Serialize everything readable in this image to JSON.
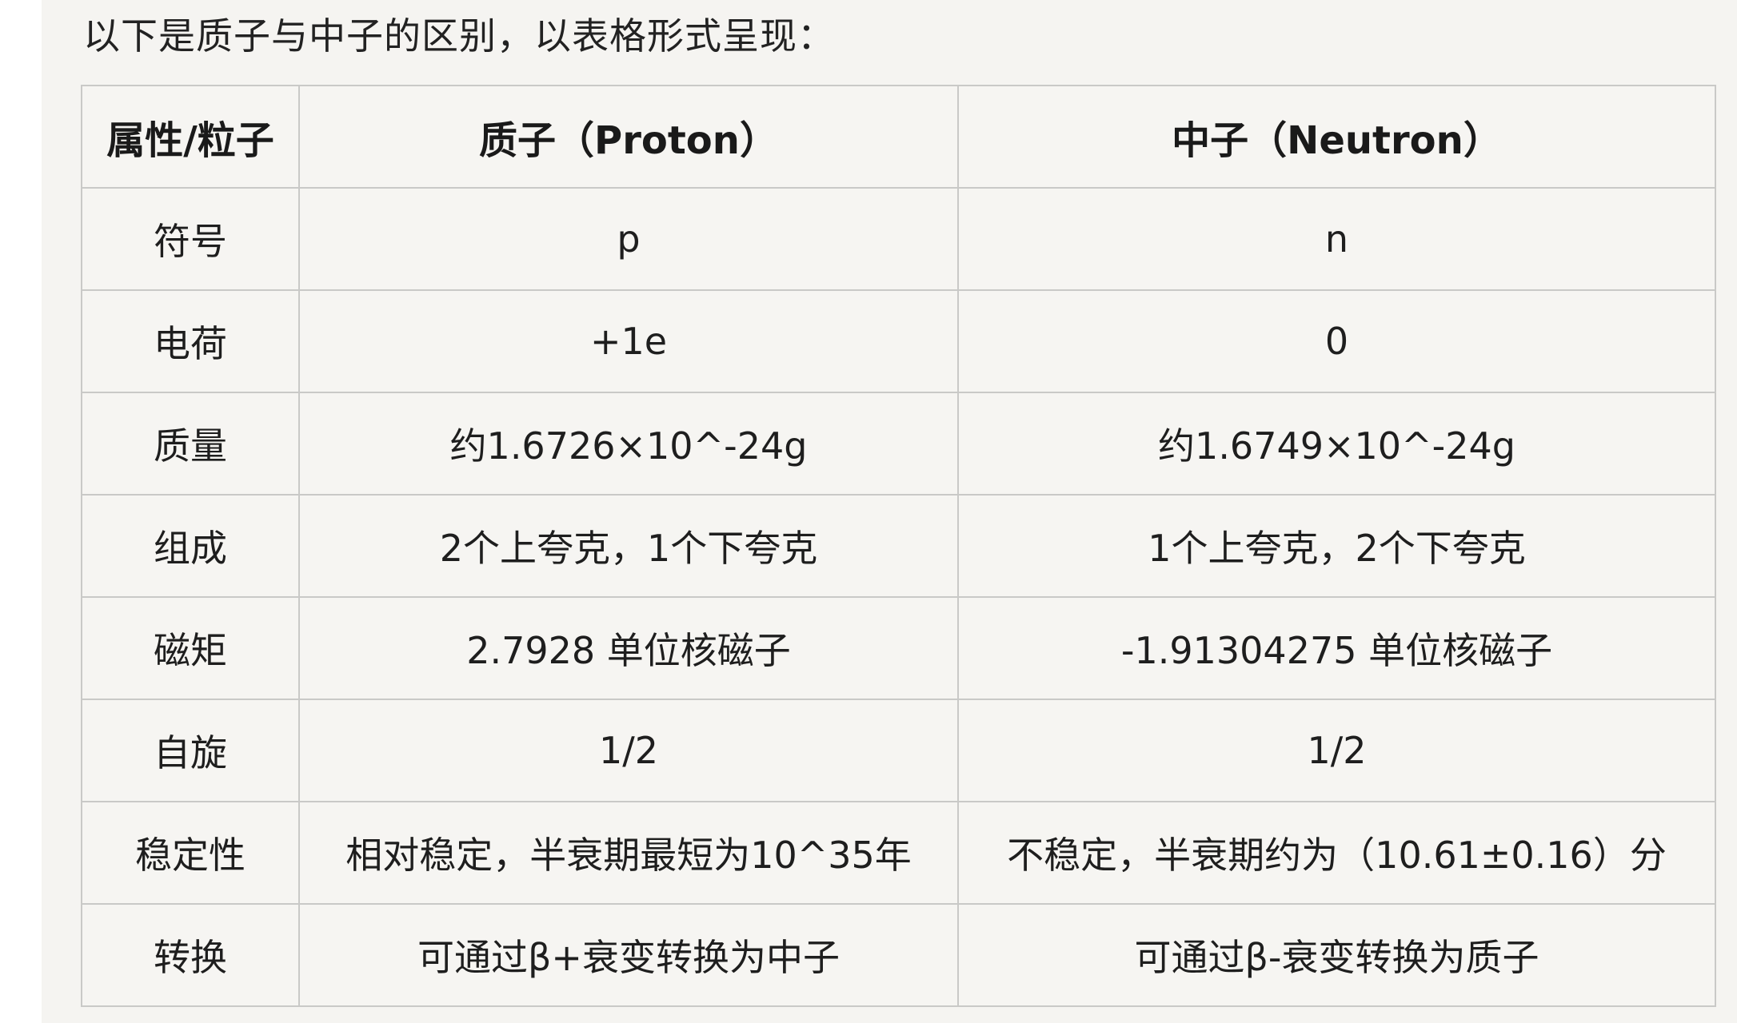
{
  "intro_text": "以下是质子与中子的区别，以表格形式呈现：",
  "table": {
    "headers": [
      "属性/粒子",
      "质子（Proton）",
      "中子（Neutron）"
    ],
    "rows": [
      {
        "property": "符号",
        "proton": "p",
        "neutron": "n"
      },
      {
        "property": "电荷",
        "proton": "+1e",
        "neutron": "0"
      },
      {
        "property": "质量",
        "proton": "约1.6726×10^-24g",
        "neutron": "约1.6749×10^-24g"
      },
      {
        "property": "组成",
        "proton": "2个上夸克，1个下夸克",
        "neutron": "1个上夸克，2个下夸克"
      },
      {
        "property": "磁矩",
        "proton": "2.7928 单位核磁子",
        "neutron": "-1.91304275 单位核磁子"
      },
      {
        "property": "自旋",
        "proton": "1/2",
        "neutron": "1/2"
      },
      {
        "property": "稳定性",
        "proton": "相对稳定，半衰期最短为10^35年",
        "neutron": "不稳定，半衰期约为（10.61±0.16）分"
      },
      {
        "property": "转换",
        "proton": "可通过β+衰变转换为中子",
        "neutron": "可通过β-衰变转换为质子"
      }
    ]
  }
}
